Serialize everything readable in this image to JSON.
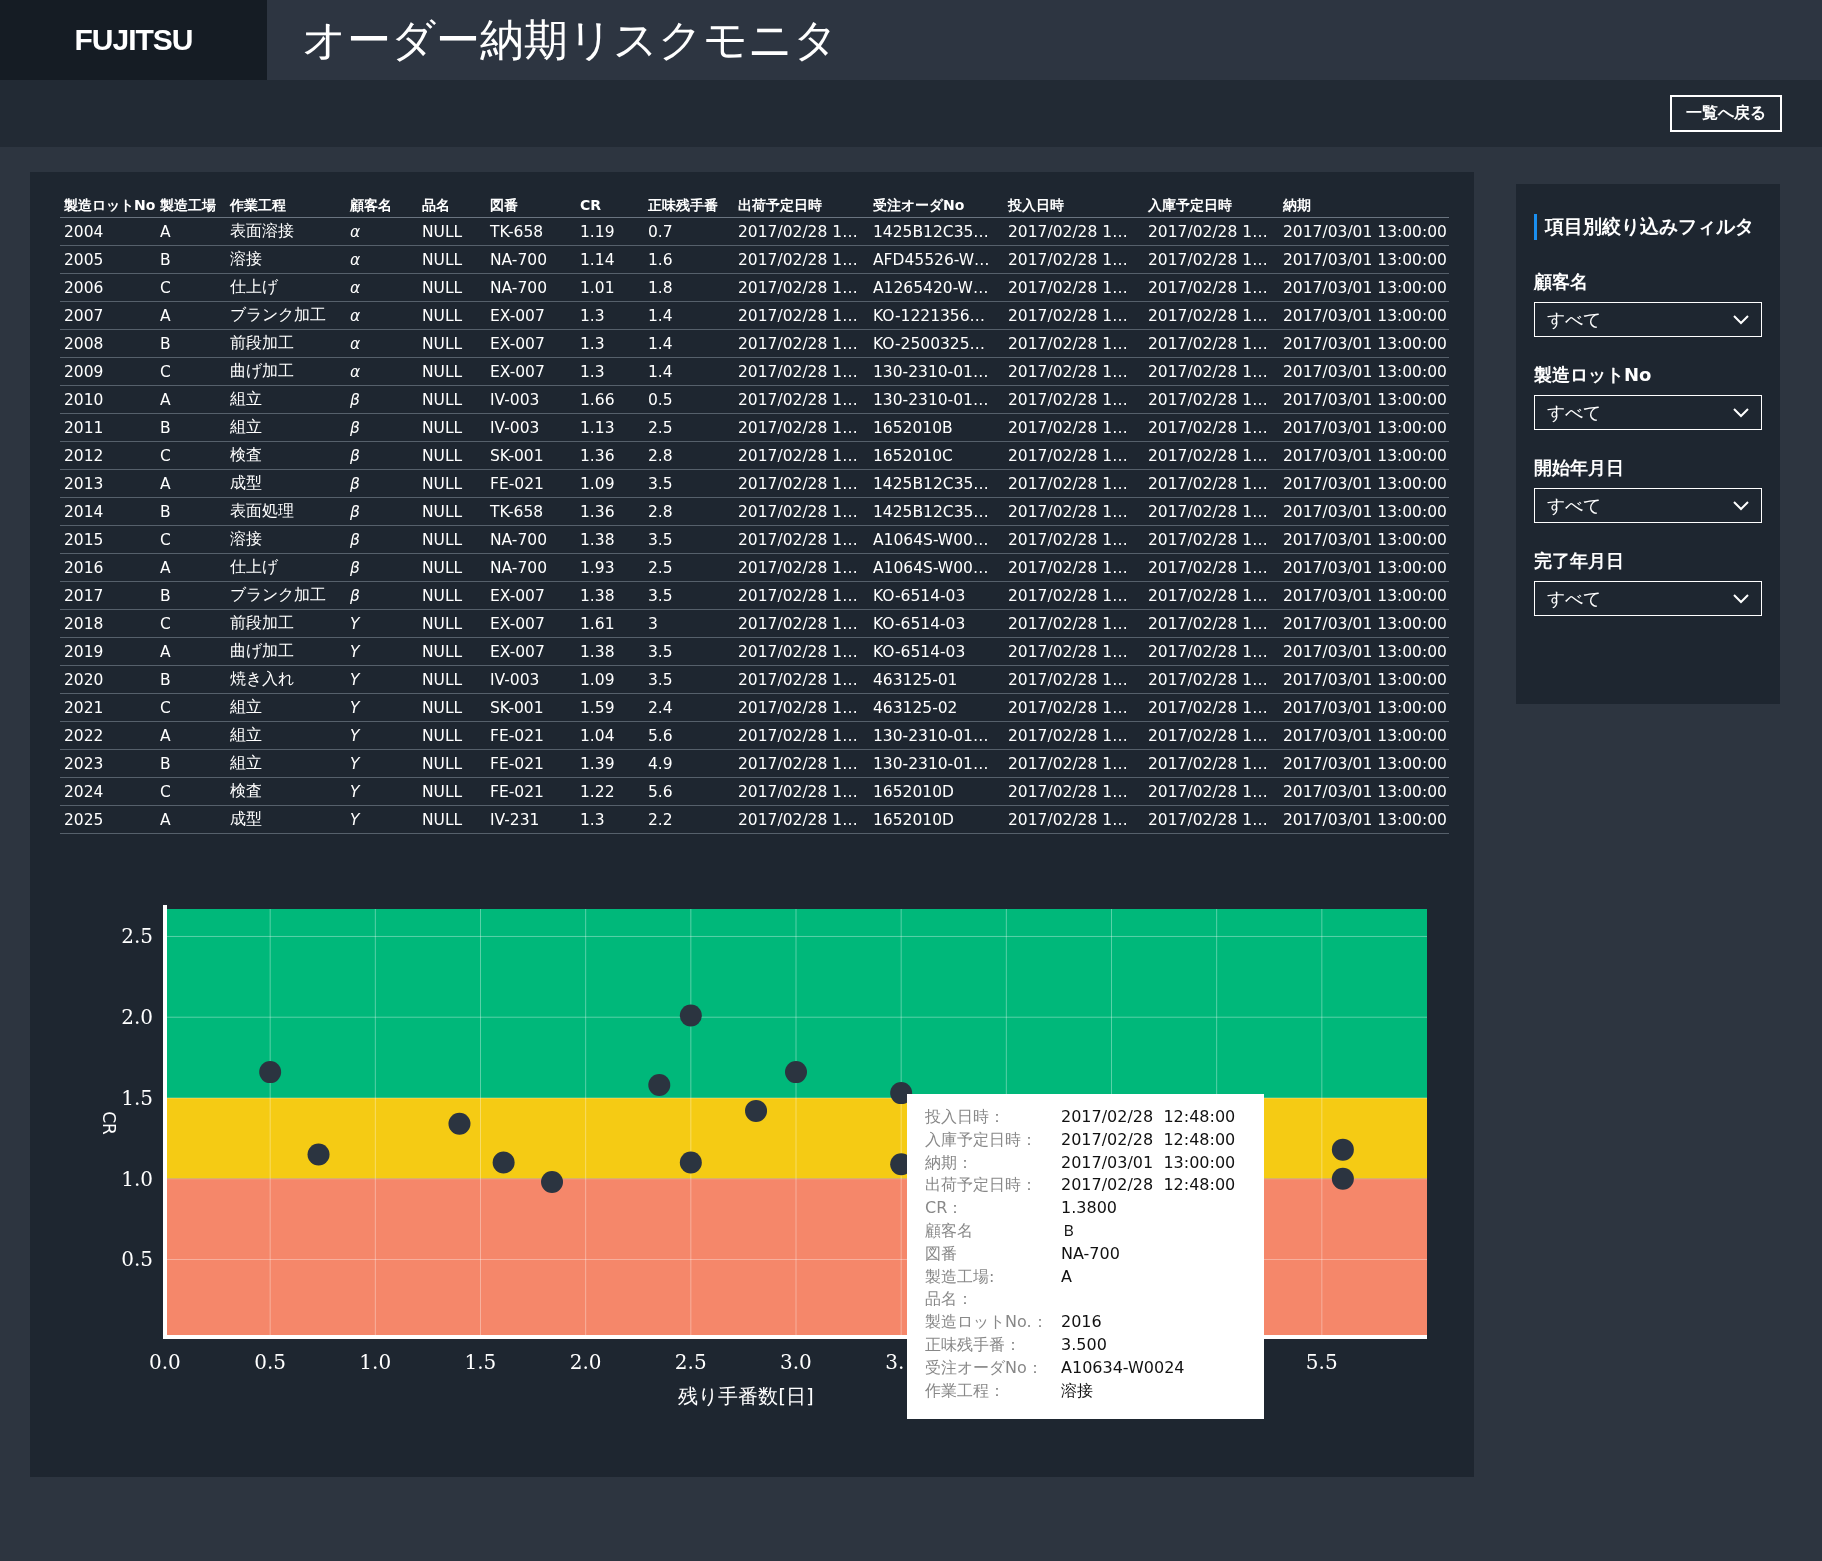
{
  "header": {
    "logo": "FUJITSU",
    "title": "オーダー納期リスクモニタ"
  },
  "toolbar": {
    "back_button": "一覧へ戻る"
  },
  "table": {
    "columns": [
      "製造ロットNo",
      "製造工場",
      "作業工程",
      "顧客名",
      "品名",
      "図番",
      "CR",
      "正味残手番",
      "出荷予定日時",
      "受注オーダNo",
      "投入日時",
      "入庫予定日時",
      "納期"
    ],
    "rows": [
      [
        "2004",
        "A",
        "表面溶接",
        "α",
        "NULL",
        "TK-658",
        "1.19",
        "0.7",
        "2017/02/28 1…",
        "1425B12C35…",
        "2017/02/28 1…",
        "2017/02/28 1…",
        "2017/03/01 13:00:00"
      ],
      [
        "2005",
        "B",
        "溶接",
        "α",
        "NULL",
        "NA-700",
        "1.14",
        "1.6",
        "2017/02/28 1…",
        "AFD45526-W…",
        "2017/02/28 1…",
        "2017/02/28 1…",
        "2017/03/01 13:00:00"
      ],
      [
        "2006",
        "C",
        "仕上げ",
        "α",
        "NULL",
        "NA-700",
        "1.01",
        "1.8",
        "2017/02/28 1…",
        "A1265420-W…",
        "2017/02/28 1…",
        "2017/02/28 1…",
        "2017/03/01 13:00:00"
      ],
      [
        "2007",
        "A",
        "ブランク加工",
        "α",
        "NULL",
        "EX-007",
        "1.3",
        "1.4",
        "2017/02/28 1…",
        "KO-1221356…",
        "2017/02/28 1…",
        "2017/02/28 1…",
        "2017/03/01 13:00:00"
      ],
      [
        "2008",
        "B",
        "前段加工",
        "α",
        "NULL",
        "EX-007",
        "1.3",
        "1.4",
        "2017/02/28 1…",
        "KO-2500325…",
        "2017/02/28 1…",
        "2017/02/28 1…",
        "2017/03/01 13:00:00"
      ],
      [
        "2009",
        "C",
        "曲げ加工",
        "α",
        "NULL",
        "EX-007",
        "1.3",
        "1.4",
        "2017/02/28 1…",
        "130-2310-01…",
        "2017/02/28 1…",
        "2017/02/28 1…",
        "2017/03/01 13:00:00"
      ],
      [
        "2010",
        "A",
        "組立",
        "β",
        "NULL",
        "IV-003",
        "1.66",
        "0.5",
        "2017/02/28 1…",
        "130-2310-01…",
        "2017/02/28 1…",
        "2017/02/28 1…",
        "2017/03/01 13:00:00"
      ],
      [
        "2011",
        "B",
        "組立",
        "β",
        "NULL",
        "IV-003",
        "1.13",
        "2.5",
        "2017/02/28 1…",
        "1652010B",
        "2017/02/28 1…",
        "2017/02/28 1…",
        "2017/03/01 13:00:00"
      ],
      [
        "2012",
        "C",
        "検査",
        "β",
        "NULL",
        "SK-001",
        "1.36",
        "2.8",
        "2017/02/28 1…",
        "1652010C",
        "2017/02/28 1…",
        "2017/02/28 1…",
        "2017/03/01 13:00:00"
      ],
      [
        "2013",
        "A",
        "成型",
        "β",
        "NULL",
        "FE-021",
        "1.09",
        "3.5",
        "2017/02/28 1…",
        "1425B12C35…",
        "2017/02/28 1…",
        "2017/02/28 1…",
        "2017/03/01 13:00:00"
      ],
      [
        "2014",
        "B",
        "表面処理",
        "β",
        "NULL",
        "TK-658",
        "1.36",
        "2.8",
        "2017/02/28 1…",
        "1425B12C35…",
        "2017/02/28 1…",
        "2017/02/28 1…",
        "2017/03/01 13:00:00"
      ],
      [
        "2015",
        "C",
        "溶接",
        "β",
        "NULL",
        "NA-700",
        "1.38",
        "3.5",
        "2017/02/28 1…",
        "A1064S-W00…",
        "2017/02/28 1…",
        "2017/02/28 1…",
        "2017/03/01 13:00:00"
      ],
      [
        "2016",
        "A",
        "仕上げ",
        "β",
        "NULL",
        "NA-700",
        "1.93",
        "2.5",
        "2017/02/28 1…",
        "A1064S-W00…",
        "2017/02/28 1…",
        "2017/02/28 1…",
        "2017/03/01 13:00:00"
      ],
      [
        "2017",
        "B",
        "ブランク加工",
        "β",
        "NULL",
        "EX-007",
        "1.38",
        "3.5",
        "2017/02/28 1…",
        "KO-6514-03",
        "2017/02/28 1…",
        "2017/02/28 1…",
        "2017/03/01 13:00:00"
      ],
      [
        "2018",
        "C",
        "前段加工",
        "Y",
        "NULL",
        "EX-007",
        "1.61",
        "3",
        "2017/02/28 1…",
        "KO-6514-03",
        "2017/02/28 1…",
        "2017/02/28 1…",
        "2017/03/01 13:00:00"
      ],
      [
        "2019",
        "A",
        "曲げ加工",
        "Y",
        "NULL",
        "EX-007",
        "1.38",
        "3.5",
        "2017/02/28 1…",
        "KO-6514-03",
        "2017/02/28 1…",
        "2017/02/28 1…",
        "2017/03/01 13:00:00"
      ],
      [
        "2020",
        "B",
        "焼き入れ",
        "Y",
        "NULL",
        "IV-003",
        "1.09",
        "3.5",
        "2017/02/28 1…",
        "463125-01",
        "2017/02/28 1…",
        "2017/02/28 1…",
        "2017/03/01 13:00:00"
      ],
      [
        "2021",
        "C",
        "組立",
        "Y",
        "NULL",
        "SK-001",
        "1.59",
        "2.4",
        "2017/02/28 1…",
        "463125-02",
        "2017/02/28 1…",
        "2017/02/28 1…",
        "2017/03/01 13:00:00"
      ],
      [
        "2022",
        "A",
        "組立",
        "Y",
        "NULL",
        "FE-021",
        "1.04",
        "5.6",
        "2017/02/28 1…",
        "130-2310-01…",
        "2017/02/28 1…",
        "2017/02/28 1…",
        "2017/03/01 13:00:00"
      ],
      [
        "2023",
        "B",
        "組立",
        "Y",
        "NULL",
        "FE-021",
        "1.39",
        "4.9",
        "2017/02/28 1…",
        "130-2310-01…",
        "2017/02/28 1…",
        "2017/02/28 1…",
        "2017/03/01 13:00:00"
      ],
      [
        "2024",
        "C",
        "検査",
        "Y",
        "NULL",
        "FE-021",
        "1.22",
        "5.6",
        "2017/02/28 1…",
        "1652010D",
        "2017/02/28 1…",
        "2017/02/28 1…",
        "2017/03/01 13:00:00"
      ],
      [
        "2025",
        "A",
        "成型",
        "Y",
        "NULL",
        "IV-231",
        "1.3",
        "2.2",
        "2017/02/28 1…",
        "1652010D",
        "2017/02/28 1…",
        "2017/02/28 1…",
        "2017/03/01 13:00:00"
      ]
    ]
  },
  "chart": {
    "chart_data": {
      "type": "scatter",
      "xlabel": "残り手番数[日]",
      "ylabel": "CR",
      "xlim": [
        0,
        6
      ],
      "ylim": [
        0.02,
        2.67
      ],
      "xticks": [
        {
          "value": 0,
          "label": "0.0"
        },
        {
          "value": 0.5,
          "label": "0.5"
        },
        {
          "value": 1,
          "label": "1.0"
        },
        {
          "value": 1.5,
          "label": "1.5"
        },
        {
          "value": 2,
          "label": "2.0"
        },
        {
          "value": 2.5,
          "label": "2.5"
        },
        {
          "value": 3,
          "label": "3.0"
        },
        {
          "value": 3.5,
          "label": "3."
        },
        {
          "value": 5.5,
          "label": "5.5"
        }
      ],
      "yticks": [
        {
          "value": 0.5,
          "label": "0.5"
        },
        {
          "value": 1,
          "label": "1.0"
        },
        {
          "value": 1.5,
          "label": "1.5"
        },
        {
          "value": 2,
          "label": "2.0"
        },
        {
          "value": 2.5,
          "label": "2.5"
        }
      ],
      "grid": true,
      "bands": [
        {
          "axis": "y",
          "from": 1.5,
          "to": 2.67,
          "color": "#00b87a"
        },
        {
          "axis": "y",
          "from": 1.0,
          "to": 1.5,
          "color": "#f5cb14"
        },
        {
          "axis": "y",
          "from": 0.02,
          "to": 1.0,
          "color": "#f5876a"
        }
      ],
      "series": [
        {
          "color": "#2b3440",
          "x": [
            0.5,
            0.73,
            1.4,
            1.61,
            1.84,
            2.35,
            2.5,
            2.5,
            2.81,
            3.0,
            3.5,
            3.5,
            5.6,
            5.6
          ],
          "values": [
            1.66,
            1.15,
            1.34,
            1.1,
            0.98,
            1.58,
            2.01,
            1.1,
            1.42,
            1.66,
            1.53,
            1.09,
            1.18,
            1.0
          ]
        }
      ]
    },
    "tooltip": [
      {
        "label": "投入日時：",
        "value": "2017/02/28  12:48:00"
      },
      {
        "label": "入庫予定日時：",
        "value": "2017/02/28  12:48:00"
      },
      {
        "label": "納期：",
        "value": "2017/03/01  13:00:00"
      },
      {
        "label": "出荷予定日時：",
        "value": "2017/02/28  12:48:00"
      },
      {
        "label": "CR：",
        "value": "1.3800"
      },
      {
        "label": "顧客名",
        "value": "Ｂ"
      },
      {
        "label": "図番",
        "value": "NA-700"
      },
      {
        "label": "製造工場:",
        "value": "A"
      },
      {
        "label": "品名："
      },
      {
        "label": "製造ロットNo.：",
        "value": "2016"
      },
      {
        "label": "正味残手番：",
        "value": "3.500"
      },
      {
        "label": "受注オーダNo：",
        "value": "A10634-W0024"
      },
      {
        "label": "作業工程：",
        "value": "溶接"
      }
    ]
  },
  "filter": {
    "title": "項目別絞り込みフィルタ",
    "fields": [
      {
        "label": "顧客名",
        "value": "すべて"
      },
      {
        "label": "製造ロットNo",
        "value": "すべて"
      },
      {
        "label": "開始年月日",
        "value": "すべて"
      },
      {
        "label": "完了年月日",
        "value": "すべて"
      }
    ]
  }
}
